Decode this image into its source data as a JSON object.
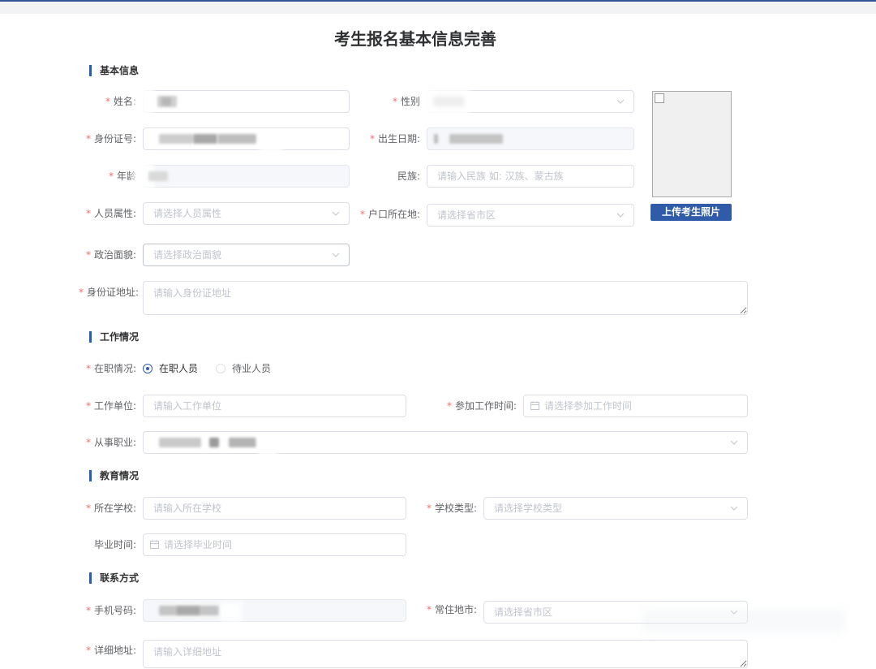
{
  "form": {
    "title": "考生报名基本信息完善",
    "required_mark": "*"
  },
  "basic_info": {
    "title": "基本信息",
    "name": {
      "label": "姓名:"
    },
    "gender": {
      "label": "性别"
    },
    "id_number": {
      "label": "身份证号:"
    },
    "birth_date": {
      "label": "出生日期:"
    },
    "age": {
      "label": "年龄"
    },
    "ethnicity": {
      "label": "民族:",
      "placeholder": "请输入民族 如: 汉族、蒙古族"
    },
    "person_type": {
      "label": "人员属性:",
      "placeholder": "请选择人员属性"
    },
    "household_location": {
      "label": "户口所在地:",
      "placeholder": "请选择省市区"
    },
    "political_status": {
      "label": "政治面貌:",
      "placeholder": "请选择政治面貌"
    },
    "id_address": {
      "label": "身份证地址:",
      "placeholder": "请输入身份证地址"
    },
    "photo": {
      "upload_label": "上传考生照片"
    }
  },
  "work_info": {
    "title": "工作情况",
    "employment_status": {
      "label": "在职情况:",
      "options": [
        "在职人员",
        "待业人员"
      ],
      "selected_index": 0
    },
    "employer": {
      "label": "工作单位:",
      "placeholder": "请输入工作单位"
    },
    "work_start_date": {
      "label": "参加工作时间:",
      "placeholder": "请选择参加工作时间"
    },
    "occupation": {
      "label": "从事职业:"
    }
  },
  "education_info": {
    "title": "教育情况",
    "school": {
      "label": "所在学校:",
      "placeholder": "请输入所在学校"
    },
    "school_type": {
      "label": "学校类型:",
      "placeholder": "请选择学校类型"
    },
    "graduation_date": {
      "label": "毕业时间:",
      "placeholder": "请选择毕业时间"
    }
  },
  "contact_info": {
    "title": "联系方式",
    "mobile": {
      "label": "手机号码:"
    },
    "residence_city": {
      "label": "常住地市:",
      "placeholder": "请选择省市区"
    },
    "detail_address": {
      "label": "详细地址:",
      "placeholder": "请输入详细地址"
    }
  },
  "theme": {
    "accent": "#2f5ba8",
    "required": "#f56c6c",
    "label": "#606266",
    "placeholder": "#c0c4cc",
    "border": "#dcdfe6",
    "disabled_bg": "#f5f7fa",
    "heading": "#303133"
  },
  "icons": {
    "select_arrow": "chevron-down-icon",
    "date_picker": "calendar-icon",
    "photo_placeholder": "broken-image-icon"
  }
}
